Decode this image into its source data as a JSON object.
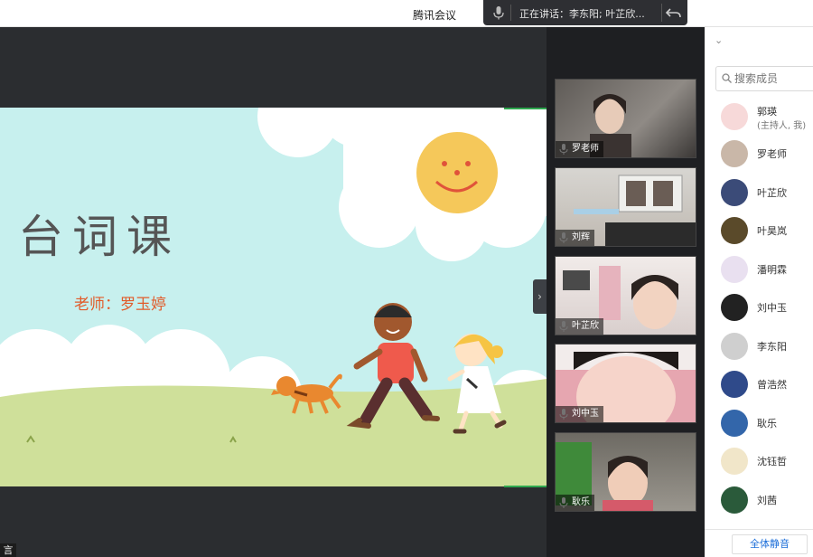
{
  "titlebar": {
    "app_title": "腾讯会议",
    "speaking_text": "正在讲话：李东阳; 叶芷欣...",
    "mic_icon": "microphone-icon",
    "reply_icon": "return-arrow-icon"
  },
  "slide": {
    "title": "台词课",
    "teacher": "老师：罗玉婷"
  },
  "stage": {
    "corner_caption": "言",
    "collapse_icon": "chevron-right-icon"
  },
  "videos": [
    {
      "name": "罗老师"
    },
    {
      "name": "刘辉"
    },
    {
      "name": "叶芷欣"
    },
    {
      "name": "刘中玉"
    },
    {
      "name": "耿乐"
    }
  ],
  "member_panel": {
    "search_placeholder": "搜索成员",
    "members": [
      {
        "name": "郭瑛",
        "role": "(主持人, 我)"
      },
      {
        "name": "罗老师",
        "role": ""
      },
      {
        "name": "叶芷欣",
        "role": ""
      },
      {
        "name": "叶昊岚",
        "role": ""
      },
      {
        "name": "潘明霖",
        "role": ""
      },
      {
        "name": "刘中玉",
        "role": ""
      },
      {
        "name": "李东阳",
        "role": ""
      },
      {
        "name": "曾浩然",
        "role": ""
      },
      {
        "name": "耿乐",
        "role": ""
      },
      {
        "name": "沈钰哲",
        "role": ""
      },
      {
        "name": "刘茜",
        "role": ""
      }
    ],
    "mute_all_label": "全体静音"
  },
  "colors": {
    "slide_sky": "#c7f0ee",
    "grass": "#cfe09a",
    "accent_green": "#2fa84f",
    "link_blue": "#1e6fd9",
    "teacher_text": "#e15b2a"
  }
}
